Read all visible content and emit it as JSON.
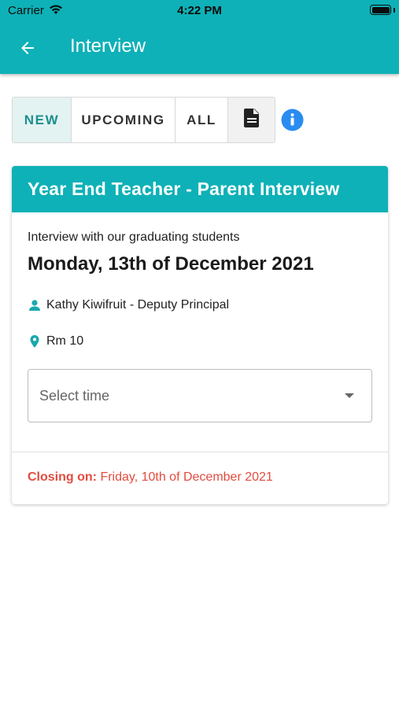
{
  "status_bar": {
    "carrier": "Carrier",
    "time": "4:22 PM"
  },
  "app_bar": {
    "title": "Interview"
  },
  "tabs": [
    {
      "label": "NEW",
      "active": true
    },
    {
      "label": "UPCOMING",
      "active": false
    },
    {
      "label": "ALL",
      "active": false
    }
  ],
  "icons": {
    "doc": "document-icon",
    "info": "info-icon",
    "person": "person-icon",
    "location": "location-pin-icon"
  },
  "interview_card": {
    "title": "Year End Teacher - Parent Interview",
    "description": "Interview with our graduating students",
    "date": "Monday, 13th of December 2021",
    "teacher": "Kathy Kiwifruit - Deputy Principal",
    "room": "Rm 10",
    "time_select": {
      "placeholder": "Select time"
    },
    "closing_label": "Closing on:",
    "closing_date": "Friday, 10th of December 2021"
  },
  "colors": {
    "primary": "#0eb1b7",
    "tab_active_bg": "#e3f3f2",
    "info_blue": "#2a8cf0",
    "danger": "#e34b3f"
  }
}
